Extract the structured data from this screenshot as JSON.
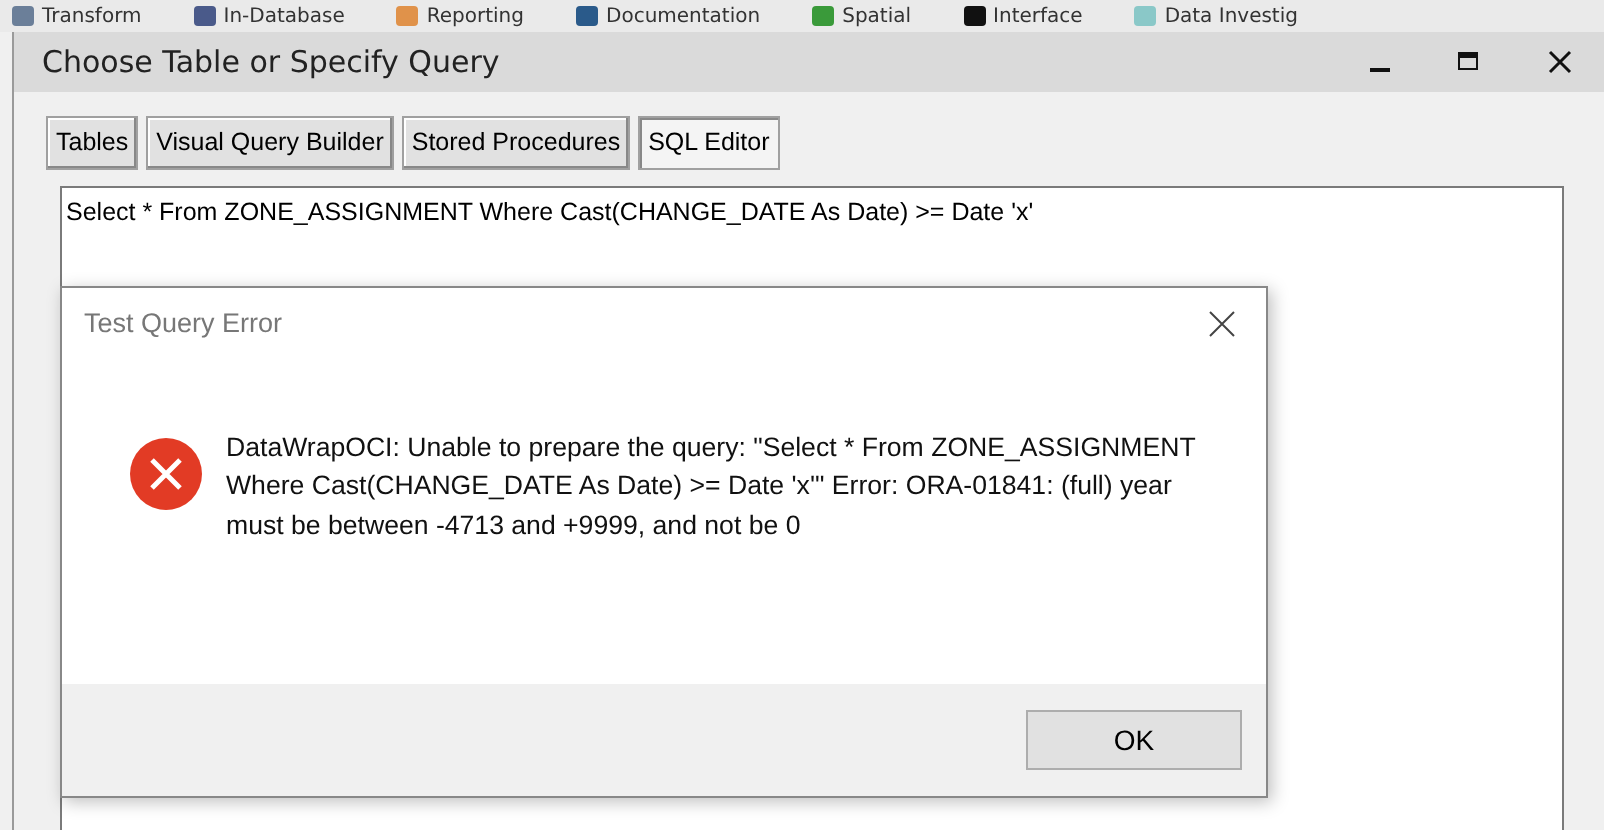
{
  "toolbar": [
    {
      "label": "Transform",
      "color": "#6b7f99"
    },
    {
      "label": "In-Database",
      "color": "#4a5a8a"
    },
    {
      "label": "Reporting",
      "color": "#e0924a"
    },
    {
      "label": "Documentation",
      "color": "#2a5a8a"
    },
    {
      "label": "Spatial",
      "color": "#3a9a3a"
    },
    {
      "label": "Interface",
      "color": "#111111"
    },
    {
      "label": "Data Investig",
      "color": "#8ac8c8"
    }
  ],
  "window": {
    "title": "Choose Table or Specify Query"
  },
  "tabs": [
    {
      "label": "Tables",
      "selected": false
    },
    {
      "label": "Visual Query Builder",
      "selected": false
    },
    {
      "label": "Stored Procedures",
      "selected": false
    },
    {
      "label": "SQL Editor",
      "selected": true
    }
  ],
  "editor": {
    "value": "Select * From ZONE_ASSIGNMENT Where Cast(CHANGE_DATE As Date) >= Date 'x'"
  },
  "dialog": {
    "title": "Test Query Error",
    "message": "DataWrapOCI: Unable to prepare the query: \"Select * From ZONE_ASSIGNMENT Where Cast(CHANGE_DATE As Date) >= Date 'x'\" Error: ORA-01841: (full) year must be between -4713 and +9999, and not be 0",
    "button": "OK"
  }
}
